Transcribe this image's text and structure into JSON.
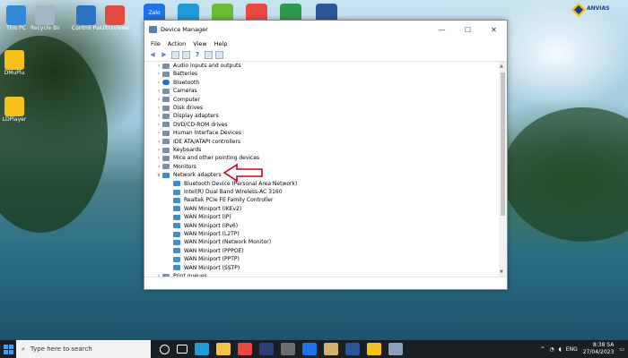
{
  "desktop": {
    "icons_left": [
      {
        "label": "This PC",
        "color": "#2e8ad8"
      },
      {
        "label": "Recycle Bin",
        "color": "#9fb7c6"
      },
      {
        "label": "Control Panel",
        "color": "#2a74c8"
      },
      {
        "label": "Ultraviewer",
        "color": "#e24a3b"
      }
    ],
    "side_icons": [
      {
        "label": "DMuPlu",
        "color": "#f6c21a"
      },
      {
        "label": "LDPlayer",
        "color": "#f6c21a"
      }
    ],
    "top_icons": [
      {
        "name": "zalo-icon",
        "label": "Zalo",
        "color": "#1d74e8"
      },
      {
        "name": "edge-icon",
        "color": "#1f9bd8"
      },
      {
        "name": "coccoc-icon",
        "color": "#6bbd36"
      },
      {
        "name": "chrome-icon",
        "color": "#e9483e"
      },
      {
        "name": "idm-icon",
        "color": "#2d9a49"
      },
      {
        "name": "word-icon",
        "color": "#2b579a"
      }
    ],
    "logo_text": "ANVIAS"
  },
  "window": {
    "title": "Device Manager",
    "controls": {
      "minimize": "—",
      "maximize": "☐",
      "close": "✕"
    },
    "menu": [
      "File",
      "Action",
      "View",
      "Help"
    ],
    "tree": [
      {
        "label": "Audio inputs and outputs",
        "expanded": false,
        "icon": "dev"
      },
      {
        "label": "Batteries",
        "expanded": false,
        "icon": "dev"
      },
      {
        "label": "Bluetooth",
        "expanded": false,
        "icon": "bt"
      },
      {
        "label": "Cameras",
        "expanded": false,
        "icon": "dev"
      },
      {
        "label": "Computer",
        "expanded": false,
        "icon": "dev"
      },
      {
        "label": "Disk drives",
        "expanded": false,
        "icon": "dev"
      },
      {
        "label": "Display adapters",
        "expanded": false,
        "icon": "dev"
      },
      {
        "label": "DVD/CD-ROM drives",
        "expanded": false,
        "icon": "dev"
      },
      {
        "label": "Human Interface Devices",
        "expanded": false,
        "icon": "dev"
      },
      {
        "label": "IDE ATA/ATAPI controllers",
        "expanded": false,
        "icon": "dev"
      },
      {
        "label": "Keyboards",
        "expanded": false,
        "icon": "dev"
      },
      {
        "label": "Mice and other pointing devices",
        "expanded": false,
        "icon": "dev"
      },
      {
        "label": "Monitors",
        "expanded": false,
        "icon": "dev"
      },
      {
        "label": "Network adapters",
        "expanded": true,
        "icon": "net"
      }
    ],
    "network_adapters": [
      "Bluetooth Device (Personal Area Network)",
      "Intel(R) Dual Band Wireless-AC 3160",
      "Realtek PCIe FE Family Controller",
      "WAN Miniport (IKEv2)",
      "WAN Miniport (IP)",
      "WAN Miniport (IPv6)",
      "WAN Miniport (L2TP)",
      "WAN Miniport (Network Monitor)",
      "WAN Miniport (PPPOE)",
      "WAN Miniport (PPTP)",
      "WAN Miniport (SSTP)"
    ],
    "after_rows": [
      "Print queues"
    ]
  },
  "taskbar": {
    "search_placeholder": "Type here to search",
    "apps": [
      {
        "name": "cortana-icon",
        "color": "#1a1f24"
      },
      {
        "name": "task-view-icon",
        "color": "#1a1f24"
      },
      {
        "name": "edge-taskbar-icon",
        "color": "#1f9bd8"
      },
      {
        "name": "explorer-icon",
        "color": "#f3c14a"
      },
      {
        "name": "chrome-taskbar-icon",
        "color": "#e9483e"
      },
      {
        "name": "photoshop-icon",
        "color": "#2a3f7a"
      },
      {
        "name": "app-icon",
        "color": "#6d6d6d"
      },
      {
        "name": "zalo-taskbar-icon",
        "color": "#1d74e8"
      },
      {
        "name": "paint-icon",
        "color": "#d7b36a"
      },
      {
        "name": "word-taskbar-icon",
        "color": "#2b579a"
      },
      {
        "name": "ldplayer-taskbar-icon",
        "color": "#f6c21a"
      },
      {
        "name": "devmgr-taskbar-icon",
        "color": "#8aa0b8"
      }
    ],
    "tray": {
      "lang": "ENG",
      "time": "8:38 SA",
      "date": "27/04/2023"
    }
  }
}
